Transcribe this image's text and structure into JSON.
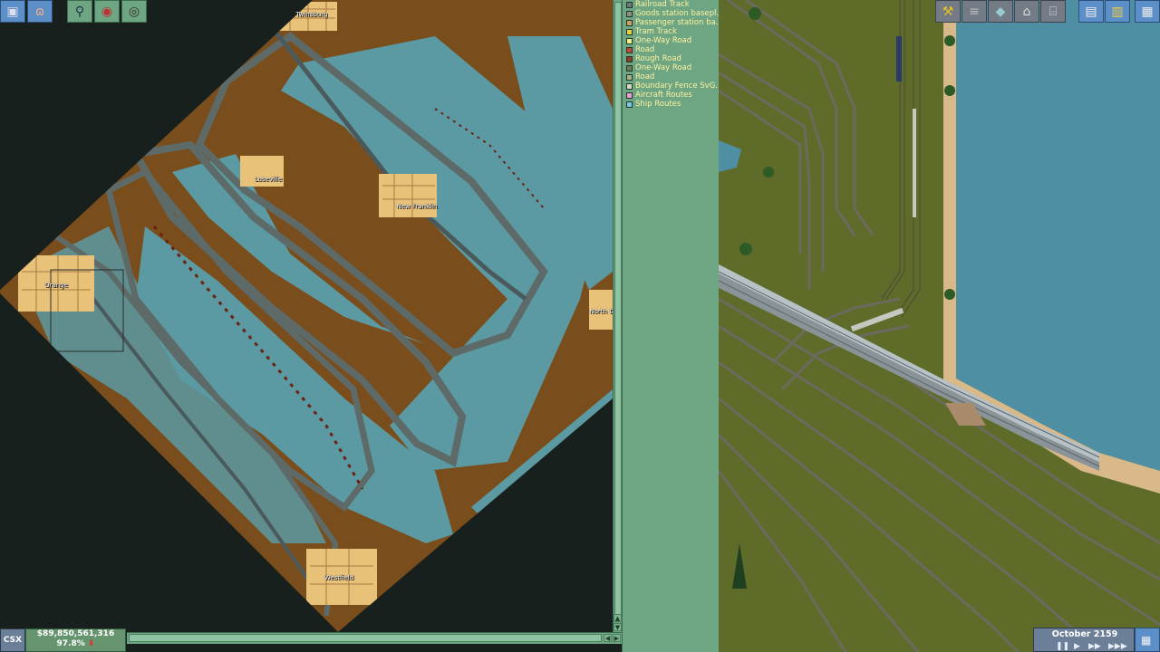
{
  "toolbar_left": [
    {
      "name": "save-icon",
      "tooltip": "save"
    },
    {
      "name": "sound-icon",
      "tooltip": "sound"
    },
    {
      "name": "zoom-in-icon",
      "tooltip": "zoom"
    },
    {
      "name": "subsidy-icon",
      "tooltip": "subsidies"
    },
    {
      "name": "eye-icon",
      "tooltip": "view"
    }
  ],
  "minimap": {
    "towns": [
      "Twinsburg",
      "Loseville",
      "New Franklin",
      "Orange",
      "North D",
      "Westfield"
    ],
    "colors": {
      "void": "#18201e",
      "land": "#7a4d1c",
      "water": "#5c9aa3",
      "rail": "#5d6a67",
      "road_deep": "#4a5a5c",
      "town": "#e9c27a"
    }
  },
  "legend": {
    "items": [
      {
        "label": "Railroad Track",
        "color": "#6b7776"
      },
      {
        "label": "Goods station basepl...",
        "color": "#8e8e80"
      },
      {
        "label": "Passenger station ba...",
        "color": "#c9a062"
      },
      {
        "label": "Tram Track",
        "color": "#e8d03a"
      },
      {
        "label": "One-Way Road",
        "color": "#f4ef85"
      },
      {
        "label": "Road",
        "color": "#c0483a"
      },
      {
        "label": "Rough Road",
        "color": "#8f3a24"
      },
      {
        "label": "One-Way Road",
        "color": "#6f7a5b"
      },
      {
        "label": "Road",
        "color": "#a9b08a"
      },
      {
        "label": "Boundary Fence SvG...",
        "color": "#d7d7c6"
      },
      {
        "label": "Aircraft Routes",
        "color": "#f29ad8"
      },
      {
        "label": "Ship Routes",
        "color": "#7ec7e2"
      }
    ]
  },
  "toolbar_right": [
    {
      "name": "build-rail-icon"
    },
    {
      "name": "build-road-icon"
    },
    {
      "name": "landscaping-icon"
    },
    {
      "name": "build-station-icon"
    },
    {
      "name": "depot-icon"
    },
    {
      "name": "train-list-icon"
    },
    {
      "name": "graphs-icon"
    },
    {
      "name": "town-list-icon"
    }
  ],
  "status": {
    "company": "CSX",
    "money": "$89,850,561,316",
    "rating": "97.8%",
    "date": "October 2159"
  },
  "colors": {
    "panel_green": "#6ea583",
    "toolbar_blue": "#5c8fc8",
    "status_text": "#fff3a0"
  }
}
